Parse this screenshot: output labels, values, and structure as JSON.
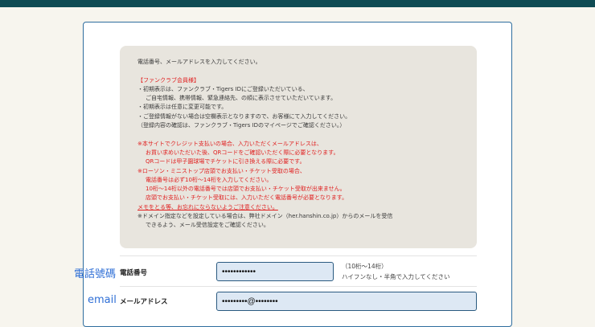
{
  "notice": {
    "lines": [
      {
        "text": "電話番号、メールアドレスを入力してください。",
        "style": ""
      },
      {
        "text": "",
        "style": "gap"
      },
      {
        "text": "【ファンクラブ会員様】",
        "style": "red"
      },
      {
        "text": "・初期表示は、ファンクラブ・Tigers IDにご登録いただいている、",
        "style": ""
      },
      {
        "text": "ご自宅情報、携帯情報、緊急連絡先、の順に表示させていただいています。",
        "style": "ind"
      },
      {
        "text": "・初期表示は任意に変更可能です。",
        "style": ""
      },
      {
        "text": "・ご登録情報がない場合は空欄表示となりますので、お客様にて入力してください。",
        "style": ""
      },
      {
        "text": "（登録内容の確認は、ファンクラブ・Tigers IDのマイページでご確認ください。）",
        "style": ""
      },
      {
        "text": "",
        "style": "gap"
      },
      {
        "text": "※本サイトでクレジット支払いの場合、入力いただくメールアドレスは、",
        "style": "red"
      },
      {
        "text": "お買い求めいただいた後、QRコードをご確認いただく際に必要となります。",
        "style": "red ind"
      },
      {
        "text": "QRコードは甲子園球場でチケットに引き換える際に必要です。",
        "style": "red ind"
      },
      {
        "text": "※ローソン・ミニストップ店頭でお支払い・チケット受取の場合、",
        "style": "red"
      },
      {
        "text": "電話番号は必ず10桁〜14桁を入力してください。",
        "style": "red ind"
      },
      {
        "text": "10桁〜14桁以外の電話番号では店頭でお支払い・チケット受取が出来ません。",
        "style": "red ind"
      },
      {
        "text": "店頭でお支払い・チケット受取には、入力いただく電話番号が必要となります。",
        "style": "red ind"
      },
      {
        "text": "メモをとる等、お忘れにならないようご注意ください。",
        "style": "red u"
      },
      {
        "text": "※ドメイン指定などを設定している場合は、弊社ドメイン（her.hanshin.co.jp）からのメールを受信",
        "style": ""
      },
      {
        "text": "できるよう、メール受信設定をご確認ください。",
        "style": "ind"
      }
    ]
  },
  "phone": {
    "side_label": "電話號碼",
    "label": "電話番号",
    "value": "••••••••••••",
    "hint_line1": "（10桁〜14桁）",
    "hint_line2": "ハイフンなし・半角で入力してください"
  },
  "email": {
    "side_label": "email",
    "label": "メールアドレス",
    "value": "•••••••••@••••••••"
  },
  "colors": {
    "topbar": "#0f4b53",
    "accent_red": "#e02020",
    "card_border": "#2f6d9e",
    "input_border": "#2a5a80",
    "side_label": "#2f6fd6"
  }
}
